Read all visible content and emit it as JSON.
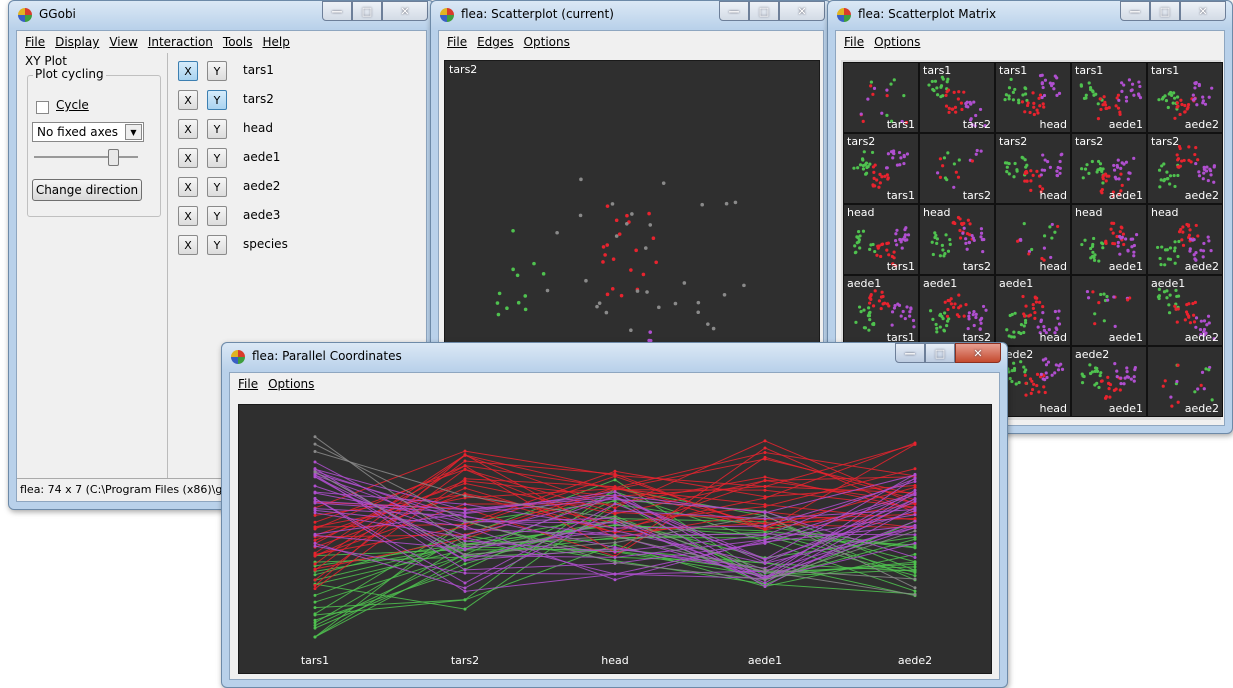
{
  "ggobi": {
    "title": "GGobi",
    "menu": [
      "File",
      "Display",
      "View",
      "Interaction",
      "Tools",
      "Help"
    ],
    "mode": "XY Plot",
    "plot_cycling": {
      "label": "Plot cycling",
      "cycle_label": "Cycle",
      "fixed_axes": "No fixed axes",
      "change_direction": "Change direction"
    },
    "variables": [
      {
        "name": "tars1",
        "x": true,
        "y": false
      },
      {
        "name": "tars2",
        "x": false,
        "y": true
      },
      {
        "name": "head",
        "x": false,
        "y": false
      },
      {
        "name": "aede1",
        "x": false,
        "y": false
      },
      {
        "name": "aede2",
        "x": false,
        "y": false
      },
      {
        "name": "aede3",
        "x": false,
        "y": false
      },
      {
        "name": "species",
        "x": false,
        "y": false
      }
    ],
    "x_label": "X",
    "y_label": "Y",
    "status": "flea: 74 x 7 (C:\\Program Files (x86)\\gg"
  },
  "scatter": {
    "title": "flea: Scatterplot (current)",
    "menu": [
      "File",
      "Edges",
      "Options"
    ],
    "y_axis_label": "tars2"
  },
  "matrix": {
    "title": "flea: Scatterplot Matrix",
    "menu": [
      "File",
      "Options"
    ],
    "vars": [
      "tars1",
      "tars2",
      "head",
      "aede1",
      "aede2"
    ]
  },
  "parcoords": {
    "title": "flea: Parallel Coordinates",
    "menu": [
      "File",
      "Options"
    ],
    "axes": [
      "tars1",
      "tars2",
      "head",
      "aede1",
      "aede2"
    ]
  },
  "colors": {
    "plot_bg": "#2f2f2f",
    "red": "#e8232e",
    "green": "#4fc24f",
    "purple": "#b04fd0",
    "gray": "#8a8a8a"
  }
}
